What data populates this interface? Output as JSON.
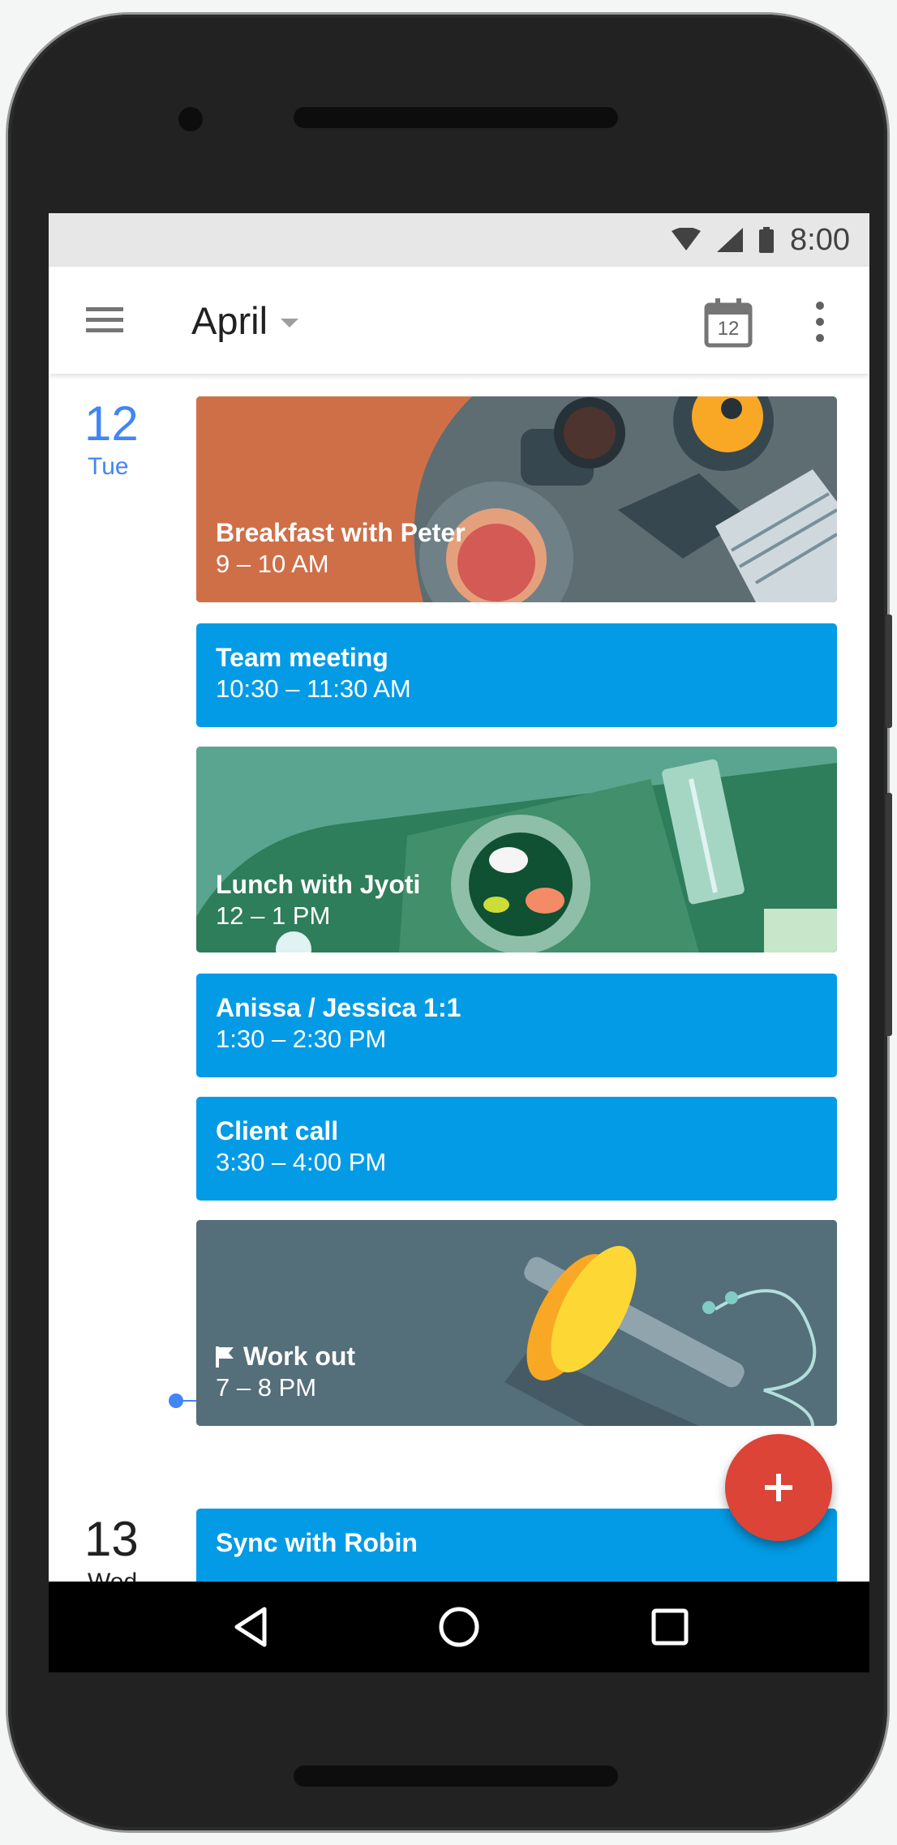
{
  "status": {
    "time": "8:00"
  },
  "appbar": {
    "title": "April",
    "calendar_day": "12"
  },
  "days": [
    {
      "number": "12",
      "name": "Tue",
      "color": "#4285f4"
    },
    {
      "number": "13",
      "name": "Wed",
      "color": "#212121"
    }
  ],
  "events": [
    {
      "title": "Breakfast with Peter",
      "time": "9 – 10 AM",
      "style": "breakfast-illustration"
    },
    {
      "title": "Team meeting",
      "time": "10:30 – 11:30 AM",
      "color": "#039be5"
    },
    {
      "title": "Lunch with Jyoti",
      "time": "12 – 1 PM",
      "style": "lunch-illustration"
    },
    {
      "title": "Anissa / Jessica 1:1",
      "time": "1:30 – 2:30 PM",
      "color": "#039be5"
    },
    {
      "title": "Client call",
      "time": "3:30 – 4:00 PM",
      "color": "#039be5"
    },
    {
      "title": "Work out",
      "time": "7 – 8 PM",
      "style": "workout-illustration",
      "icon": "flag-icon"
    },
    {
      "title": "Sync with Robin",
      "time": "",
      "color": "#039be5"
    }
  ],
  "colors": {
    "accent": "#4285f4",
    "event_blue": "#039be5",
    "fab": "#db4437"
  },
  "fab": {
    "icon": "plus-icon"
  }
}
